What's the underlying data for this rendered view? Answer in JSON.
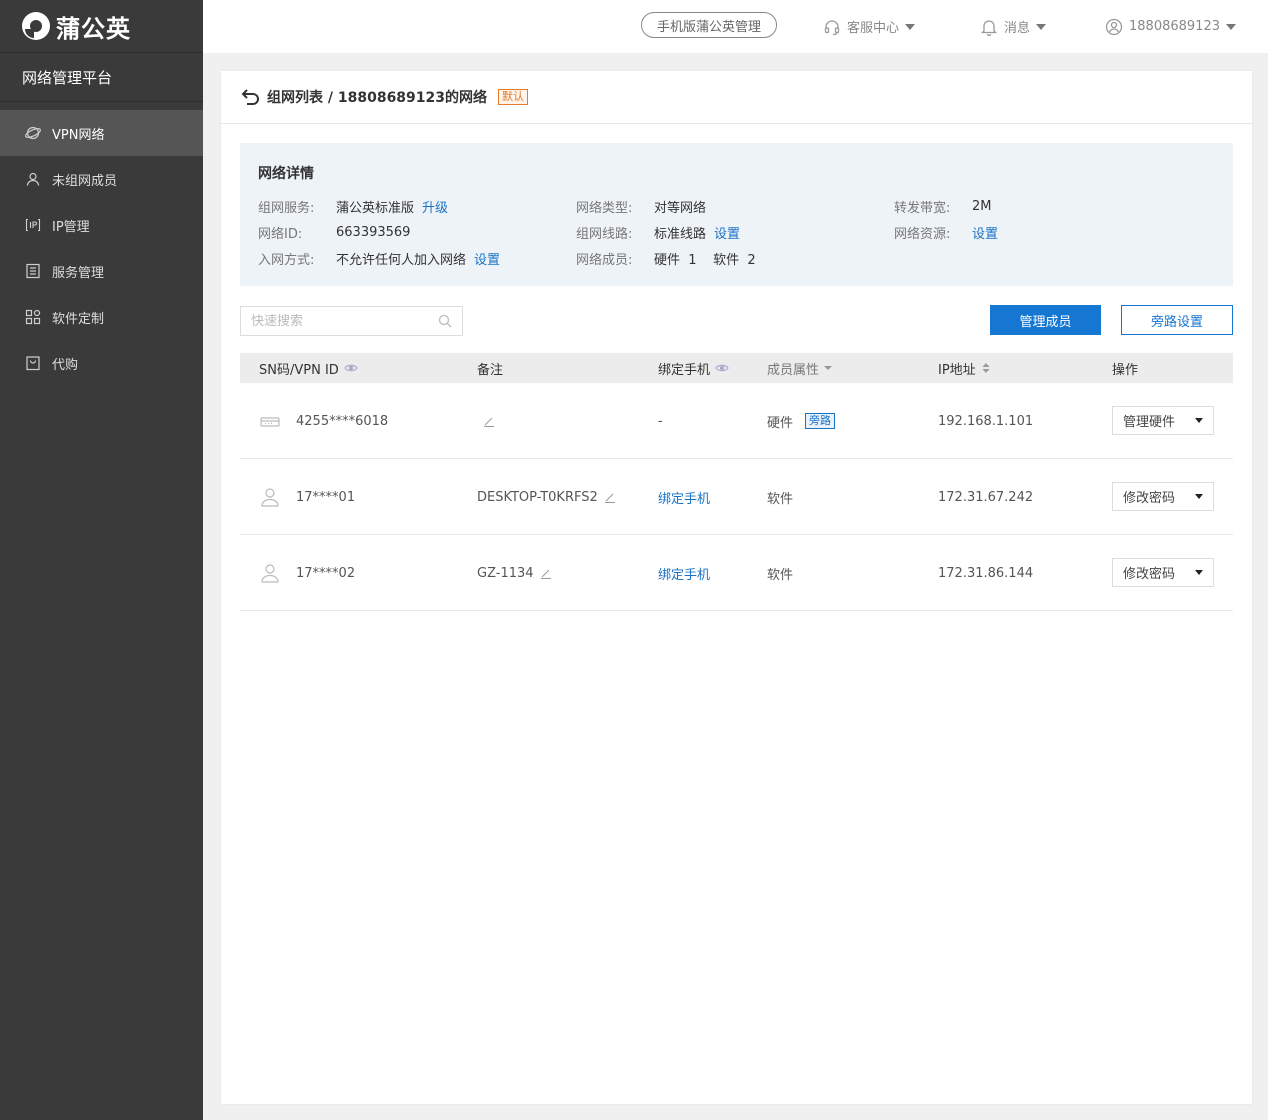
{
  "app": {
    "logo_text": "蒲公英",
    "platform_name": "网络管理平台"
  },
  "sidebar": {
    "items": [
      {
        "label": "VPN网络",
        "icon": "globe-icon",
        "active": true
      },
      {
        "label": "未组网成员",
        "icon": "user-icon",
        "active": false
      },
      {
        "label": "IP管理",
        "icon": "ip-icon",
        "active": false
      },
      {
        "label": "服务管理",
        "icon": "list-icon",
        "active": false
      },
      {
        "label": "软件定制",
        "icon": "grid-icon",
        "active": false
      },
      {
        "label": "代购",
        "icon": "bag-icon",
        "active": false
      }
    ]
  },
  "header": {
    "mobile_label": "手机版蒲公英管理",
    "support_label": "客服中心",
    "messages_label": "消息",
    "account_label": "18808689123"
  },
  "page": {
    "breadcrumb": "组网列表 / 18808689123的网络",
    "default_badge": "默认"
  },
  "details": {
    "title": "网络详情",
    "service_label": "组网服务:",
    "service_value": "蒲公英标准版",
    "service_link": "升级",
    "type_label": "网络类型:",
    "type_value": "对等网络",
    "bandwidth_label": "转发带宽:",
    "bandwidth_value": "2M",
    "id_label": "网络ID:",
    "id_value": "663393569",
    "line_label": "组网线路:",
    "line_value": "标准线路",
    "line_link": "设置",
    "resource_label": "网络资源:",
    "resource_link": "设置",
    "join_label": "入网方式:",
    "join_value": "不允许任何人加入网络",
    "join_link": "设置",
    "members_label": "网络成员:",
    "members_value": "硬件  1    软件  2"
  },
  "toolbar": {
    "search_placeholder": "快速搜索",
    "manage_members": "管理成员",
    "bypass_settings": "旁路设置"
  },
  "table": {
    "headers": {
      "sn": "SN码/VPN ID",
      "remark": "备注",
      "phone": "绑定手机",
      "attr": "成员属性",
      "ip": "IP地址",
      "action": "操作"
    },
    "rows": [
      {
        "icon": "router-icon",
        "id": "4255****6018",
        "remark": "",
        "phone": "-",
        "phone_is_link": false,
        "attr": "硬件",
        "tag": "旁路",
        "ip": "192.168.1.101",
        "action": "管理硬件"
      },
      {
        "icon": "person-icon",
        "id": "17****01",
        "remark": "DESKTOP-T0KRFS2",
        "phone": "绑定手机",
        "phone_is_link": true,
        "attr": "软件",
        "tag": "",
        "ip": "172.31.67.242",
        "action": "修改密码"
      },
      {
        "icon": "person-icon",
        "id": "17****02",
        "remark": "GZ-1134",
        "phone": "绑定手机",
        "phone_is_link": true,
        "attr": "软件",
        "tag": "",
        "ip": "172.31.86.144",
        "action": "修改密码"
      }
    ]
  }
}
